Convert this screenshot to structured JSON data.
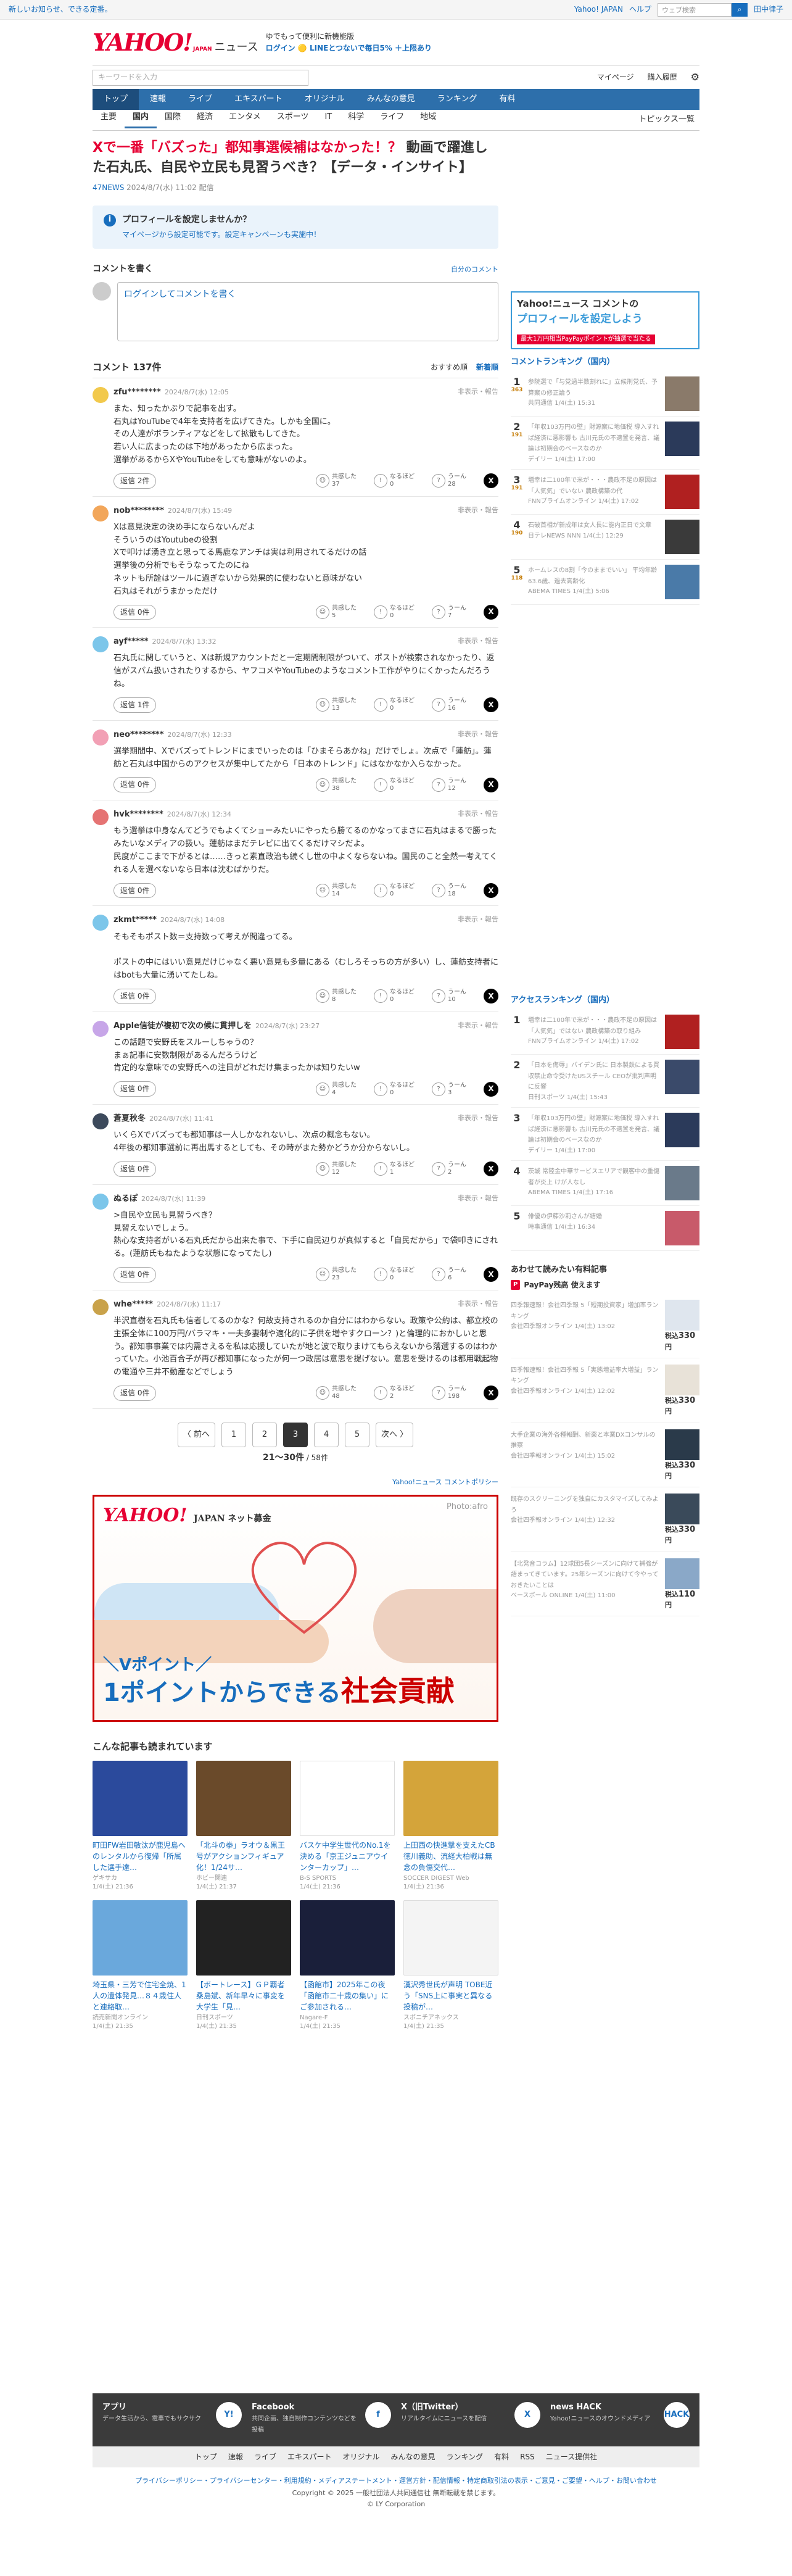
{
  "topbar": {
    "left": "新しいお知らせ、できる定番。",
    "yahoo_link": "Yahoo! JAPAN",
    "help": "ヘルプ",
    "search_placeholder": "ウェブ検索",
    "user": "田中律子"
  },
  "header": {
    "logo": "YAHOO!",
    "logo_sub": "JAPAN",
    "service": "ニュース",
    "promo1": "ゆでもって便利に新機能版",
    "promo2": "ログイン 🟡 LINEとつないで毎日5% ＋上限あり"
  },
  "search": {
    "placeholder": "キーワードを入力",
    "mypage": "マイページ",
    "history": "購入履歴"
  },
  "gnav": [
    "トップ",
    "速報",
    "ライブ",
    "エキスパート",
    "オリジナル",
    "みんなの意見",
    "ランキング",
    "有料"
  ],
  "snav": {
    "items": [
      "主要",
      "国内",
      "国際",
      "経済",
      "エンタメ",
      "スポーツ",
      "IT",
      "科学",
      "ライフ",
      "地域"
    ],
    "right": "トピックス一覧"
  },
  "article": {
    "title_red": "Xで一番「バズった」都知事選候補はなかった！？",
    "title_rest": " 動画で躍進した石丸氏、自民や立民も見習うべき？【データ・インサイト】",
    "source": "47NEWS",
    "date": "2024/8/7(水) 11:02 配信"
  },
  "profile": {
    "title": "プロフィールを設定しませんか？",
    "sub": "マイページから設定可能です。設定キャンペーンも実施中！"
  },
  "write": {
    "heading": "コメントを書く",
    "right": "自分のコメント",
    "placeholder": "ログインしてコメントを書く"
  },
  "comments_head": {
    "title": "コメント 137件",
    "tab1": "おすすめ順",
    "tab2": "新着順"
  },
  "comments": [
    {
      "user": "zfu********",
      "date": "2024/8/7(水) 12:05",
      "text": "また、知ったかぶりで記事を出す。\n石丸はYouTubeで4年を支持者を広げてきた。しかも全国に。\nその人達がボランティアなどをして拡散もしてきた。\n若い人に広まったのは下地があったから広まった。\n選挙があるからXやYouTubeをしても意味がないのよ。",
      "reply": "返信 2件",
      "good": "37",
      "bad": "0",
      "neutral": "28",
      "color": "#f2c94c"
    },
    {
      "user": "nob********",
      "date": "2024/8/7(水) 15:49",
      "text": "Xは意見決定の決め手にならないんだよ\nそういうのはYoutubeの役割\nXで叩けば湧き立と思ってる馬鹿なアンチは実は利用されてるだけの話\n選挙後の分析でもそうなってたのにね\nネットも所詮はツールに過ぎないから効果的に使わないと意味がない\n石丸はそれがうまかっただけ",
      "reply": "返信 0件",
      "good": "5",
      "bad": "0",
      "neutral": "7",
      "color": "#f2a65a"
    },
    {
      "user": "ayf*****",
      "date": "2024/8/7(水) 13:32",
      "text": "石丸氏に関していうと、Xは新規アカウントだと一定期間制限がついて、ポストが検索されなかったり、返信がスパム扱いされたりするから、ヤフコメやYouTubeのようなコメント工作がやりにくかったんだろうね。",
      "reply": "返信 1件",
      "good": "13",
      "bad": "0",
      "neutral": "16",
      "color": "#7cc6ea"
    },
    {
      "user": "neo********",
      "date": "2024/8/7(水) 12:33",
      "text": "選挙期間中、Xでバズってトレンドにまでいったのは「ひまそらあかね」だけでしょ。次点で「蓮舫」。蓮舫と石丸は中国からのアクセスが集中してたから「日本のトレンド」にはなかなか入らなかった。",
      "reply": "返信 0件",
      "good": "38",
      "bad": "0",
      "neutral": "12",
      "color": "#f2a0b5"
    },
    {
      "user": "hvk********",
      "date": "2024/8/7(水) 12:34",
      "text": "もう選挙は中身なんてどうでもよくてショーみたいにやったら勝てるのかなってまさに石丸はまるで勝ったみたいなメディアの扱い。蓮舫はまだテレビに出てくるだけマシだよ。\n民度がここまで下がるとは……きっと素直政治も続くし世の中よくならないね。国民のこと全然一考えてくれる人を選べないなら日本は沈むばかりだ。",
      "reply": "返信 0件",
      "good": "14",
      "bad": "0",
      "neutral": "18",
      "color": "#e57373"
    },
    {
      "user": "zkmt*****",
      "date": "2024/8/7(水) 14:08",
      "text": "そもそもポスト数＝支持数って考えが間違ってる。\n\nポストの中にはいい意見だけじゃなく悪い意見も多量にある（むしろそっちの方が多い）し、蓮舫支持者にはbotも大量に湧いてたしね。",
      "reply": "返信 0件",
      "good": "8",
      "bad": "0",
      "neutral": "10",
      "color": "#7cc6ea"
    },
    {
      "user": "Apple信徒が複初で次の候に貫押しを",
      "date": "2024/8/7(水) 23:27",
      "text": "この話題で安野氏をスルーしちゃうの？\nまぁ記事に安数制限があるんだろうけど\n肯定的な意味での安野氏への注目がどれだけ集まったかは知りたいw",
      "reply": "返信 0件",
      "good": "4",
      "bad": "0",
      "neutral": "3",
      "color": "#c7a6e8"
    },
    {
      "user": "蒼夏秋冬",
      "date": "2024/8/7(水) 11:41",
      "text": "いくらXでバズっても都知事は一人しかなれないし、次点の概念もない。\n4年後の都知事選前に再出馬するとしても、その時がまた勢かどうか分からないし。",
      "reply": "返信 0件",
      "good": "12",
      "bad": "1",
      "neutral": "2",
      "color": "#3d4a5c"
    },
    {
      "user": "ぬるぽ",
      "date": "2024/8/7(水) 11:39",
      "text": ">自民や立民も見習うべき？\n見習えないでしょう。\n熱心な支持者がいる石丸氏だから出来た事で、下手に自民辺りが真似すると「自民だから」で袋叩きにされる。(蓮舫氏もねたような状態になってたし)",
      "reply": "返信 0件",
      "good": "23",
      "bad": "0",
      "neutral": "6",
      "color": "#7cc6ea"
    },
    {
      "user": "whe*****",
      "date": "2024/8/7(水) 11:17",
      "text": "半沢直樹を石丸氏も信者してるのかな？何故支持されるのか自分にはわからない。政策や公約は、都立校の主張全体に100万円/バラマキ・一夫多妻制や適化的に子供を増やすクローン？)と倫理的におかしいと思う。都知事事業では内需さえるを私は応援していたが地と波で取りまけてもらえないから落選するのはわかっていた。小池百合子が再び都知事になったが何一つ政居は意思を提げない。意思を受けるのは都用戦起物の電通や三井不動産などでしょう",
      "reply": "返信 0件",
      "good": "48",
      "bad": "2",
      "neutral": "198",
      "color": "#c9a24a"
    }
  ],
  "vote_labels": {
    "good": "共感した",
    "bad": "なるほど",
    "neutral": "うーん"
  },
  "report_text": "非表示・報告",
  "pager": {
    "prev": "〈 前へ",
    "pages": [
      "1",
      "2",
      "3",
      "4",
      "5"
    ],
    "next": "次へ 〉",
    "note_b": "21〜30件",
    "note_rest": " / 58件"
  },
  "policy": "Yahoo!ニュース コメントポリシー",
  "banner": {
    "logo": "YAHOO!",
    "logo_sub": "JAPAN ネット募金",
    "photo": "Photo:afro",
    "line1": "＼Vポイント／",
    "line2a": "1ポイントからできる",
    "line2b": "社会貢献"
  },
  "read": {
    "heading": "こんな記事も読まれています",
    "cards": [
      {
        "title": "町田FW岩田敏汰が鹿児島へのレンタルから復帰「所属した選手達…",
        "src": "ゲキサカ",
        "date": "1/4(土) 21:36",
        "color": "#2b4a9c"
      },
      {
        "title": "「北斗の拳」ラオウ＆黒王号がアクションフィギュア化！1/24サ…",
        "src": "ホビー関連",
        "date": "1/4(土) 21:37",
        "color": "#6a4a2a"
      },
      {
        "title": "バスケ中学生世代のNo.1を決める「京王ジュニアウインターカップ」…",
        "src": "B-S SPORTS",
        "date": "1/4(土) 21:36",
        "color": "#ffffff"
      },
      {
        "title": "上田西の快進撃を支えたCB徳川義助、流経大柏戦は無念の負傷交代…",
        "src": "SOCCER DIGEST Web",
        "date": "1/4(土) 21:36",
        "color": "#d4a43a"
      },
      {
        "title": "埼玉県・三芳で住宅全焼、1人の遺体発見…８４歳住人と連絡取…",
        "src": "読売新聞オンライン",
        "date": "1/4(土) 21:35",
        "color": "#6aa8dc"
      },
      {
        "title": "【ボートレース】ＧＰ覇者桑島斌、新年早々に事変を大学生「見…",
        "src": "日刊スポーツ",
        "date": "1/4(土) 21:35",
        "color": "#222222"
      },
      {
        "title": "【函館市】2025年この夜「函館市二十歳の集い」にご参加される…",
        "src": "Nagare-F",
        "date": "1/4(土) 21:35",
        "color": "#1a1f3a"
      },
      {
        "title": "漢沢秀世氏が声明 TOBE近う「SNS上に事実と異なる投稿が…",
        "src": "スポニチアネックス",
        "date": "1/4(土) 21:35",
        "color": "#f4f4f4"
      }
    ]
  },
  "side": {
    "ad": {
      "l1": "Yahoo!ニュース コメントの",
      "l2": "プロフィールを設定しよう",
      "l3": "最大1万円相当PayPayポイントが抽選で当たる"
    },
    "comment_rank_h": "コメントランキング（国内）",
    "comment_rank": [
      {
        "n": "1",
        "cnt": "363",
        "title": "参院選で「与党過半数割れに」立候刑党氏、予算案の修正論う",
        "src": "共同通信",
        "date": "1/4(土) 15:31",
        "color": "#8a7a6a"
      },
      {
        "n": "2",
        "cnt": "191",
        "title": "「年収103万円の壁」財源案に地価税 導入すれば経済に悪影響も 古川元氏の不適置を発言、議論は初期会のベースなのか",
        "src": "デイリー",
        "date": "1/4(土) 17:00",
        "color": "#2b3a5a"
      },
      {
        "n": "3",
        "cnt": "191",
        "title": "増幸は二100年で米が・・・農政不足の原因は「人気気」でいない 農政構築の代",
        "src": "FNNプライムオンライン",
        "date": "1/4(土) 17:02",
        "color": "#b02020"
      },
      {
        "n": "4",
        "cnt": "190",
        "title": "石破首相が新成年は女人長に能内正日で文章",
        "src": "日テレNEWS NNN",
        "date": "1/4(土) 12:29",
        "color": "#3a3a3a"
      },
      {
        "n": "5",
        "cnt": "118",
        "title": "ホームレスの8割「今のままでいい」 平均年齢63.6歳、過去高齢化",
        "src": "ABEMA TIMES",
        "date": "1/4(土) 5:06",
        "color": "#4a7aa8"
      }
    ],
    "access_rank_h": "アクセスランキング（国内）",
    "access_rank": [
      {
        "n": "1",
        "title": "増幸は二100年で米が・・・農政不足の原因は「人気気」ではない 農政構築の取り組み",
        "src": "FNNプライムオンライン",
        "date": "1/4(土) 17:02",
        "color": "#b02020"
      },
      {
        "n": "2",
        "title": "「日本を侮辱」バイデン氏に 日本製鉄による買収禁止命令受けたUSスチール CEOが批判声明に反響",
        "src": "日刊スポーツ",
        "date": "1/4(土) 15:43",
        "color": "#3a4a6a"
      },
      {
        "n": "3",
        "title": "「年収103万円の壁」財源案に地価税 導入すれば経済に悪影響も 古川元氏の不適置を発言、議論は初期会のベースなのか",
        "src": "デイリー",
        "date": "1/4(土) 17:00",
        "color": "#2b3a5a"
      },
      {
        "n": "4",
        "title": "茨城 常陸金中華サービスエリアで観客中の重傷者が炎上 けが人なし",
        "src": "ABEMA TIMES",
        "date": "1/4(土) 17:16",
        "color": "#6a7a8a"
      },
      {
        "n": "5",
        "title": "俳優の伊藤沙莉さんが結婚",
        "src": "時事通信",
        "date": "1/4(土) 16:34",
        "color": "#c85a6a"
      }
    ],
    "rec_h": "あわせて読みたい有料記事",
    "rec_pay": "PayPay残高 使えます",
    "recs": [
      {
        "title": "四季報速報！会社四季報 5「短期投資家」増加率ランキング",
        "src": "会社四季報オンライン",
        "date": "1/4(土) 13:02",
        "price": "330",
        "color": "#dfe6ee"
      },
      {
        "title": "四季報速報！会社四季報 5「実態増益率大増益」ランキング",
        "src": "会社四季報オンライン",
        "date": "1/4(土) 12:02",
        "price": "330",
        "color": "#e8e2d8"
      },
      {
        "title": "大手企業の海外各種報酬、新薬と本業DXコンサルの推察",
        "src": "会社四季報オンライン",
        "date": "1/4(土) 15:02",
        "price": "330",
        "color": "#2a3a4a"
      },
      {
        "title": "既存のスクリーニングを独自にカスタマイズしてみよう",
        "src": "会社四季報オンライン",
        "date": "1/4(土) 12:32",
        "price": "330",
        "color": "#3a4a5a"
      },
      {
        "title": "【北発音コラム】12球団5長シーズンに向けて補強が語まってきています。25年シーズンに向けて今やっておきたいことは",
        "src": "ベースボール ONLINE",
        "date": "1/4(土) 11:00",
        "price": "110",
        "color": "#8aa8c8"
      }
    ],
    "price_prefix": "税込",
    "price_suffix": "円"
  },
  "footer": {
    "apps": [
      {
        "name": "アプリ",
        "desc": "データ生活から、電車でもサクサク",
        "icon": "Y!"
      },
      {
        "name": "Facebook",
        "desc": "共同企画、独自制作コンテンツなどを投稿",
        "icon": "f"
      },
      {
        "name": "X（旧Twitter）",
        "desc": "リアルタイムにニュースを配信",
        "icon": "X"
      },
      {
        "name": "news HACK",
        "desc": "Yahoo!ニュースのオウンドメディア",
        "icon": "HACK"
      }
    ],
    "nav": [
      "トップ",
      "速報",
      "ライブ",
      "エキスパート",
      "オリジナル",
      "みんなの意見",
      "ランキング",
      "有料",
      "RSS",
      "ニュース提供社"
    ],
    "links": "プライバシーポリシー・プライバシーセンター・利用規約・メディアステートメント・運営方針・配信情報・特定商取引法の表示・ご意見・ご要望・ヘルプ・お問い合わせ",
    "copy1": "Copyright © 2025 一般社団法人共同通信社 無断転載を禁じます。",
    "copy2": "© LY Corporation"
  }
}
